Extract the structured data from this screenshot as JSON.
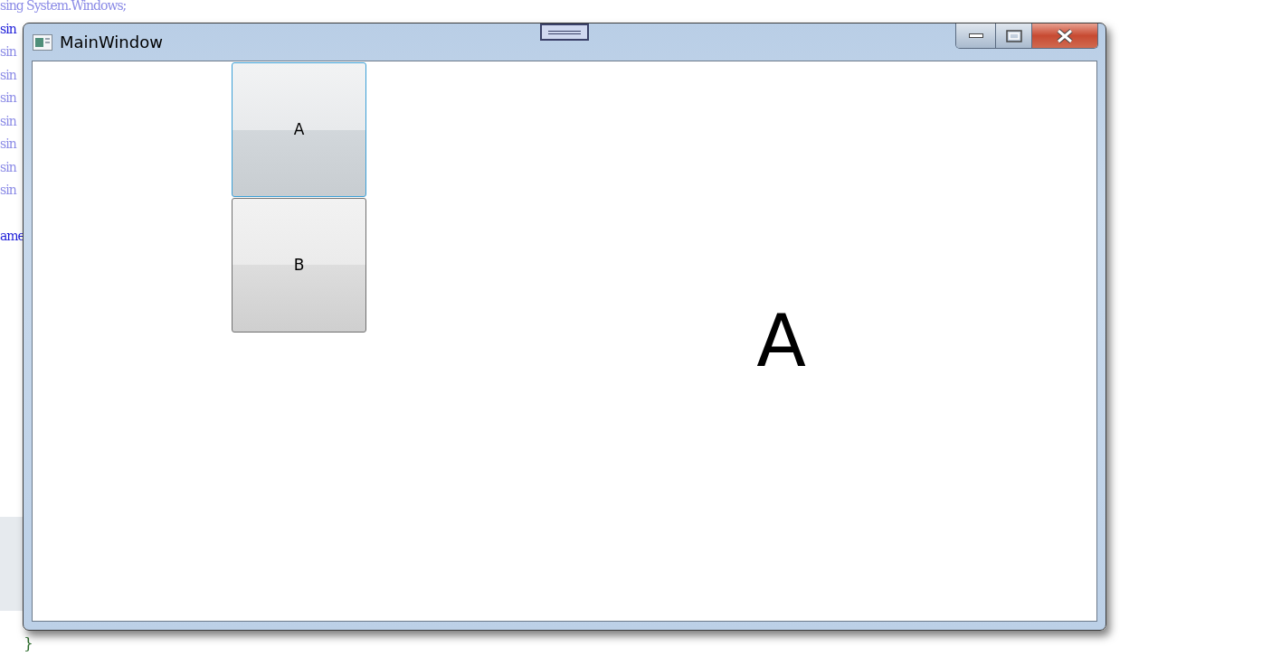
{
  "background_code": {
    "lines": [
      {
        "text": "sing System.Windows;",
        "kind": "faded"
      },
      {
        "text": "sin",
        "kind": "keyword"
      },
      {
        "text": "sin",
        "kind": "faded"
      },
      {
        "text": "sin",
        "kind": "faded"
      },
      {
        "text": "sin",
        "kind": "faded"
      },
      {
        "text": "sin",
        "kind": "faded"
      },
      {
        "text": "sin",
        "kind": "faded"
      },
      {
        "text": "sin",
        "kind": "faded"
      },
      {
        "text": "sin",
        "kind": "faded"
      },
      {
        "kind": "blank"
      },
      {
        "text": "ame",
        "kind": "keyword"
      }
    ],
    "closing_brace": "}"
  },
  "window": {
    "title": "MainWindow",
    "buttons": [
      {
        "label": "A",
        "focused": true
      },
      {
        "label": "B",
        "focused": false
      }
    ],
    "display_text": "A"
  }
}
